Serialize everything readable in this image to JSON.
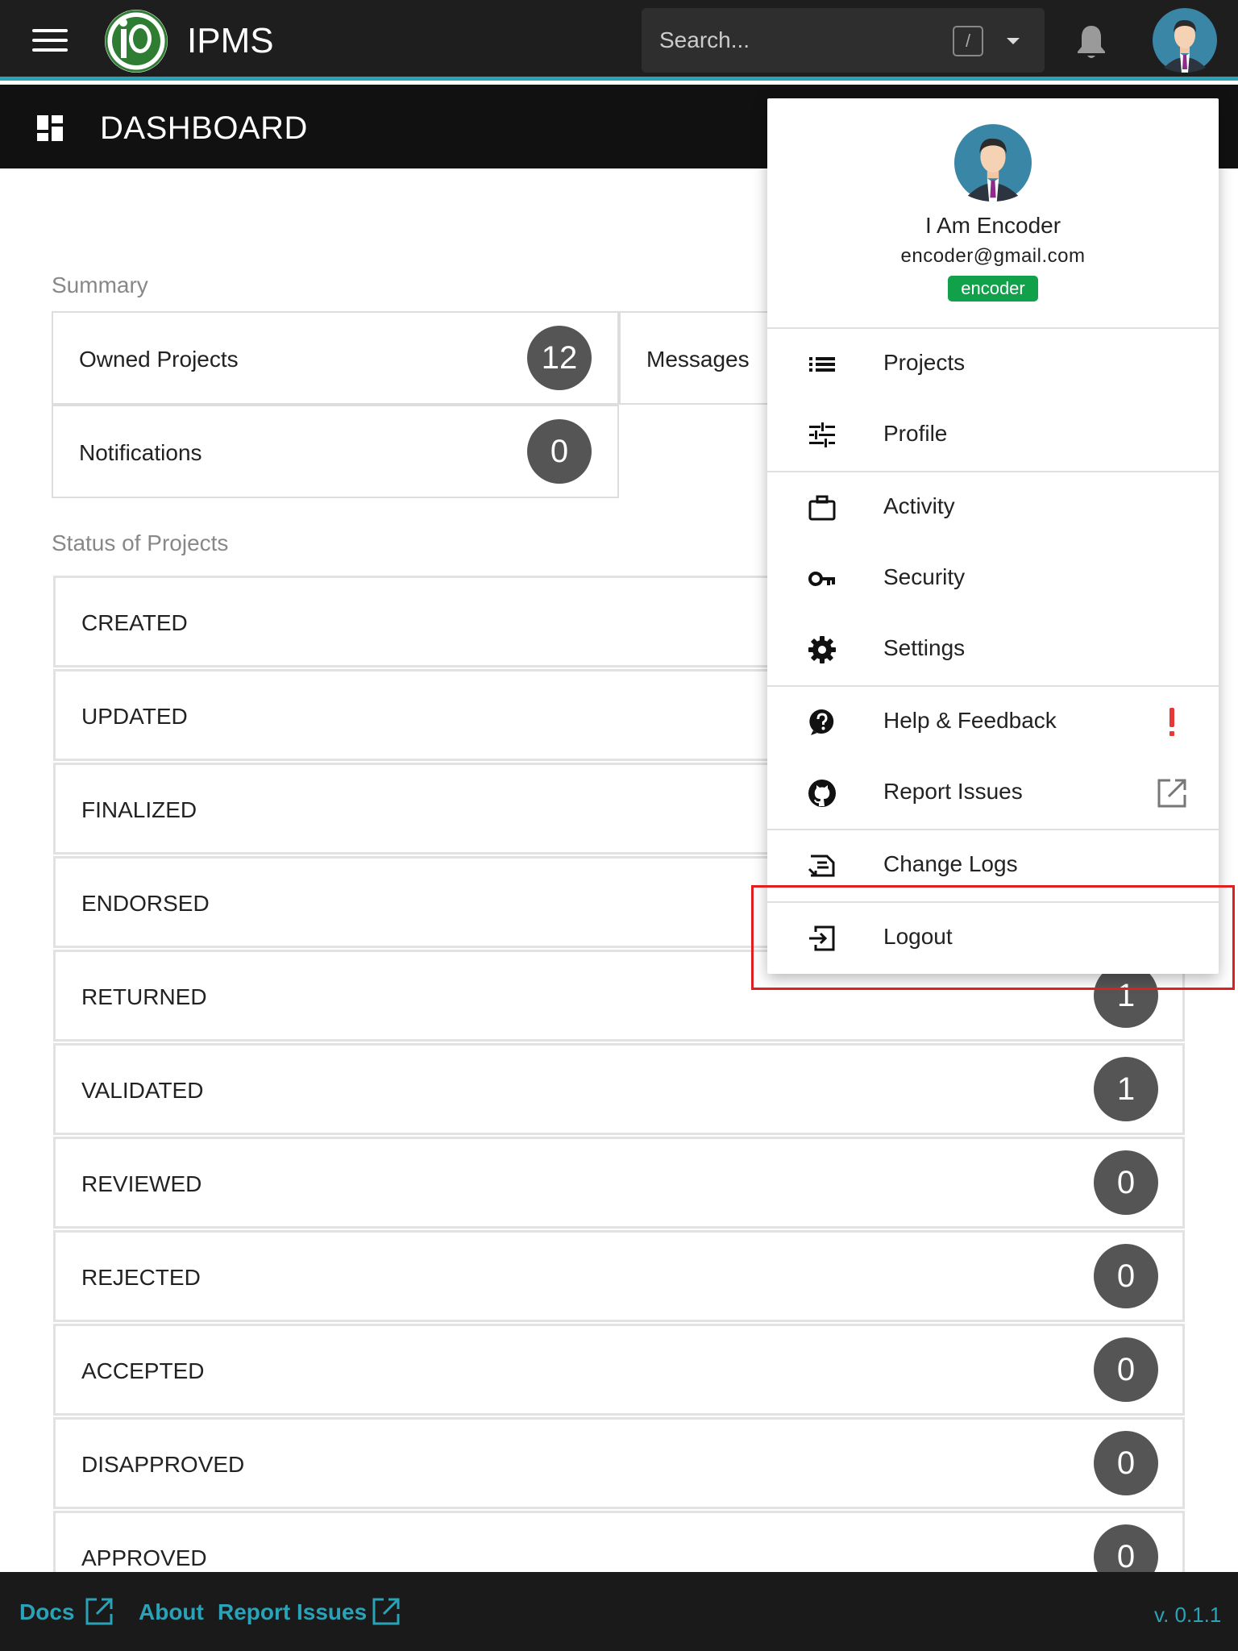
{
  "header": {
    "app_title": "IPMS",
    "search_placeholder": "Search...",
    "search_shortcut": "/",
    "accent_color": "#2aa3b8"
  },
  "dashboard": {
    "title": "DASHBOARD"
  },
  "summary": {
    "label": "Summary",
    "owned_projects": {
      "label": "Owned Projects",
      "count": "12"
    },
    "messages": {
      "label": "Messages"
    },
    "notifications": {
      "label": "Notifications",
      "count": "0"
    }
  },
  "status": {
    "label": "Status of Projects",
    "rows": [
      {
        "label": "CREATED",
        "count": ""
      },
      {
        "label": "UPDATED",
        "count": ""
      },
      {
        "label": "FINALIZED",
        "count": ""
      },
      {
        "label": "ENDORSED",
        "count": ""
      },
      {
        "label": "RETURNED",
        "count": "1"
      },
      {
        "label": "VALIDATED",
        "count": "1"
      },
      {
        "label": "REVIEWED",
        "count": "0"
      },
      {
        "label": "REJECTED",
        "count": "0"
      },
      {
        "label": "ACCEPTED",
        "count": "0"
      },
      {
        "label": "DISAPPROVED",
        "count": "0"
      },
      {
        "label": "APPROVED",
        "count": "0"
      }
    ]
  },
  "user_menu": {
    "name": "I Am Encoder",
    "email": "encoder@gmail.com",
    "role": "encoder",
    "role_color": "#12a14b",
    "items": [
      {
        "label": "Projects",
        "icon": "list-icon"
      },
      {
        "label": "Profile",
        "icon": "tune-icon"
      },
      {
        "label": "Activity",
        "icon": "briefcase-icon"
      },
      {
        "label": "Security",
        "icon": "key-icon"
      },
      {
        "label": "Settings",
        "icon": "gear-icon"
      },
      {
        "label": "Help & Feedback",
        "icon": "help-icon",
        "extra": "alert-icon"
      },
      {
        "label": "Report Issues",
        "icon": "github-icon",
        "extra": "external-link-icon"
      },
      {
        "label": "Change Logs",
        "icon": "changelog-icon"
      },
      {
        "label": "Logout",
        "icon": "logout-icon"
      }
    ]
  },
  "footer": {
    "docs": "Docs",
    "about": "About",
    "report_issues": "Report Issues",
    "version": "v. 0.1.1"
  }
}
